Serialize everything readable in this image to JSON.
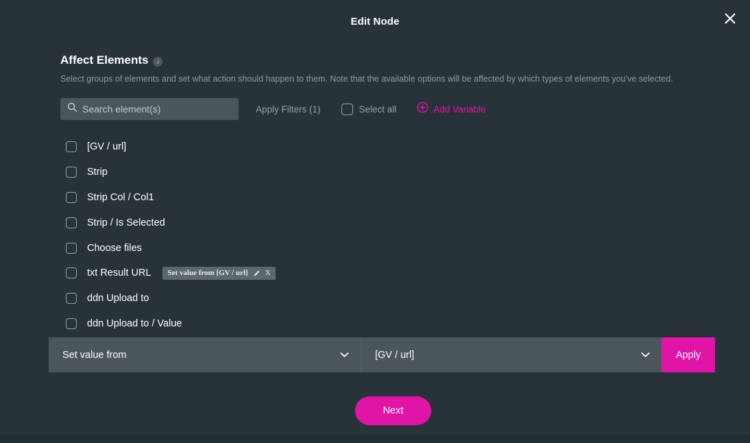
{
  "modal": {
    "title": "Edit Node",
    "close_icon": "close-icon"
  },
  "section": {
    "title": "Affect Elements",
    "info_icon": "i",
    "description": "Select groups of elements and set what action should happen to them. Note that the available options will be affected by which types of elements you've selected."
  },
  "toolbar": {
    "search_placeholder": "Search element(s)",
    "search_value": "",
    "search_icon": "search-icon",
    "apply_filters_label": "Apply Filters (1)",
    "select_all_label": "Select all",
    "add_variable_label": "Add Variable",
    "add_variable_icon": "plus-circle-icon"
  },
  "elements": [
    {
      "label": "[GV / url]",
      "checked": false
    },
    {
      "label": "Strip",
      "checked": false
    },
    {
      "label": "Strip Col / Col1",
      "checked": false
    },
    {
      "label": "Strip / Is Selected",
      "checked": false
    },
    {
      "label": "Choose files",
      "checked": false
    },
    {
      "label": "txt Result URL",
      "checked": false,
      "badge": {
        "text": "Set value from [GV / url]",
        "edit_icon": "pencil-icon",
        "remove_label": "X"
      }
    },
    {
      "label": "ddn Upload to",
      "checked": false
    },
    {
      "label": "ddn Upload to / Value",
      "checked": false
    }
  ],
  "action_bar": {
    "action_dropdown_value": "Set value from",
    "source_dropdown_value": "[GV / url]",
    "apply_label": "Apply",
    "chevron_icon": "chevron-down-icon"
  },
  "footer": {
    "next_label": "Next"
  },
  "colors": {
    "background": "#283339",
    "surface": "#4a565c",
    "accent": "#e114a8",
    "muted_text": "#8fa3ac",
    "badge": "#5c686e"
  }
}
